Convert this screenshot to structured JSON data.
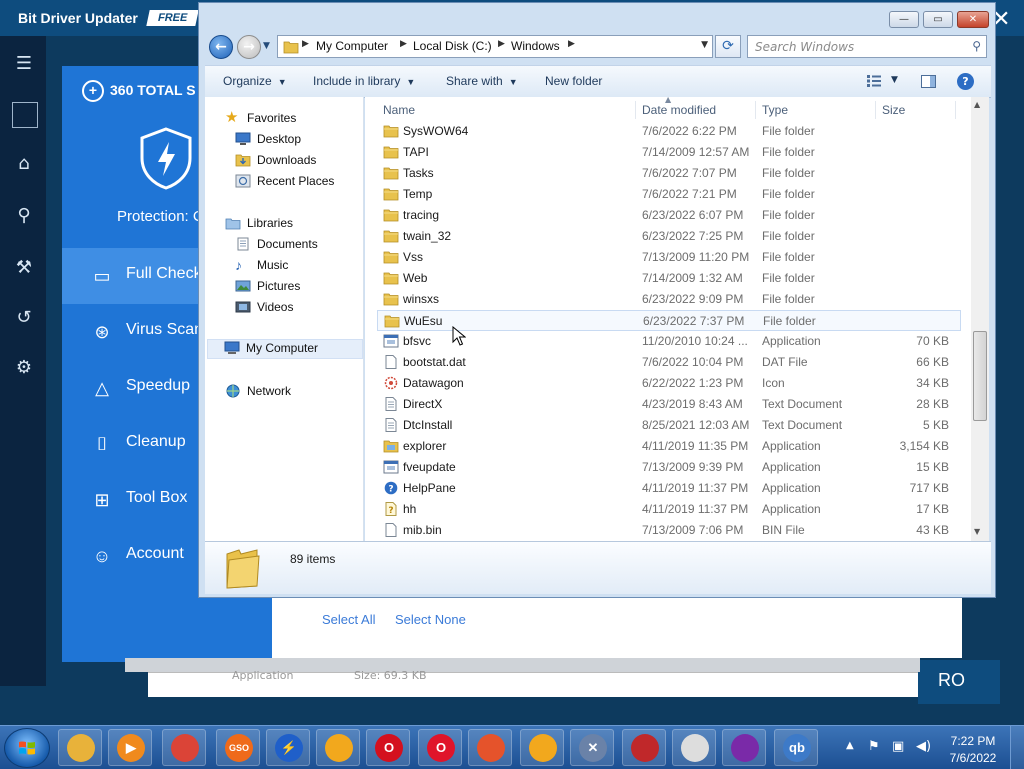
{
  "bg_app": {
    "title": "Bit Driver Updater",
    "badge": "FREE",
    "pro_text": "RO"
  },
  "security_app": {
    "brand": "360 TOTAL S",
    "protection": "Protection: C",
    "menu": [
      {
        "label": "Full Check",
        "icon": "monitor-icon",
        "active": true
      },
      {
        "label": "Virus Scan",
        "icon": "virus-scan-icon"
      },
      {
        "label": "Speedup",
        "icon": "rocket-icon"
      },
      {
        "label": "Cleanup",
        "icon": "broom-icon"
      },
      {
        "label": "Tool Box",
        "icon": "toolbox-icon"
      },
      {
        "label": "Account",
        "icon": "account-icon"
      }
    ],
    "select_all": "Select All",
    "select_none": "Select None",
    "strip_text_1": "Application",
    "strip_text_2": "Size: 69.3 KB"
  },
  "explorer": {
    "address": [
      "My Computer",
      "Local Disk (C:)",
      "Windows"
    ],
    "search_placeholder": "Search Windows",
    "toolbar": {
      "organize": "Organize",
      "include": "Include in library",
      "share": "Share with",
      "new_folder": "New folder"
    },
    "nav": {
      "favorites": "Favorites",
      "favorites_items": [
        "Desktop",
        "Downloads",
        "Recent Places"
      ],
      "libraries": "Libraries",
      "libraries_items": [
        "Documents",
        "Music",
        "Pictures",
        "Videos"
      ],
      "computer": "My Computer",
      "network": "Network"
    },
    "columns": {
      "name": "Name",
      "date": "Date modified",
      "type": "Type",
      "size": "Size"
    },
    "files": [
      {
        "name": "SysWOW64",
        "date": "7/6/2022 6:22 PM",
        "type": "File folder",
        "size": "",
        "icon": "folder"
      },
      {
        "name": "TAPI",
        "date": "7/14/2009 12:57 AM",
        "type": "File folder",
        "size": "",
        "icon": "folder"
      },
      {
        "name": "Tasks",
        "date": "7/6/2022 7:07 PM",
        "type": "File folder",
        "size": "",
        "icon": "folder"
      },
      {
        "name": "Temp",
        "date": "7/6/2022 7:21 PM",
        "type": "File folder",
        "size": "",
        "icon": "folder"
      },
      {
        "name": "tracing",
        "date": "6/23/2022 6:07 PM",
        "type": "File folder",
        "size": "",
        "icon": "folder"
      },
      {
        "name": "twain_32",
        "date": "6/23/2022 7:25 PM",
        "type": "File folder",
        "size": "",
        "icon": "folder"
      },
      {
        "name": "Vss",
        "date": "7/13/2009 11:20 PM",
        "type": "File folder",
        "size": "",
        "icon": "folder"
      },
      {
        "name": "Web",
        "date": "7/14/2009 1:32 AM",
        "type": "File folder",
        "size": "",
        "icon": "folder"
      },
      {
        "name": "winsxs",
        "date": "6/23/2022 9:09 PM",
        "type": "File folder",
        "size": "",
        "icon": "folder"
      },
      {
        "name": "WuEsu",
        "date": "6/23/2022 7:37 PM",
        "type": "File folder",
        "size": "",
        "icon": "folder"
      },
      {
        "name": "bfsvc",
        "date": "11/20/2010 10:24 ...",
        "type": "Application",
        "size": "70 KB",
        "icon": "app"
      },
      {
        "name": "bootstat.dat",
        "date": "7/6/2022 10:04 PM",
        "type": "DAT File",
        "size": "66 KB",
        "icon": "file"
      },
      {
        "name": "Datawagon",
        "date": "6/22/2022 1:23 PM",
        "type": "Icon",
        "size": "34 KB",
        "icon": "ico"
      },
      {
        "name": "DirectX",
        "date": "4/23/2019 8:43 AM",
        "type": "Text Document",
        "size": "28 KB",
        "icon": "text"
      },
      {
        "name": "DtcInstall",
        "date": "8/25/2021 12:03 AM",
        "type": "Text Document",
        "size": "5 KB",
        "icon": "text"
      },
      {
        "name": "explorer",
        "date": "4/11/2019 11:35 PM",
        "type": "Application",
        "size": "3,154 KB",
        "icon": "explorer"
      },
      {
        "name": "fveupdate",
        "date": "7/13/2009 9:39 PM",
        "type": "Application",
        "size": "15 KB",
        "icon": "app"
      },
      {
        "name": "HelpPane",
        "date": "4/11/2019 11:37 PM",
        "type": "Application",
        "size": "717 KB",
        "icon": "help"
      },
      {
        "name": "hh",
        "date": "4/11/2019 11:37 PM",
        "type": "Application",
        "size": "17 KB",
        "icon": "hh"
      },
      {
        "name": "mib.bin",
        "date": "7/13/2009 7:06 PM",
        "type": "BIN File",
        "size": "43 KB",
        "icon": "file"
      }
    ],
    "item_count": "89 items"
  },
  "taskbar": {
    "apps": [
      {
        "name": "windows-explorer",
        "color": "#e8b23a",
        "glyph": ""
      },
      {
        "name": "media-player",
        "color": "#f08a1d",
        "glyph": "▶"
      },
      {
        "name": "chrome",
        "color": "#db4437",
        "glyph": ""
      },
      {
        "name": "iobit-gso",
        "color": "#ef6a1a",
        "glyph": "GSO"
      },
      {
        "name": "shield-app",
        "color": "#1f5fc9",
        "glyph": "⚡"
      },
      {
        "name": "torch-browser",
        "color": "#f2a81d",
        "glyph": ""
      },
      {
        "name": "opera",
        "color": "#d4101e",
        "glyph": "O"
      },
      {
        "name": "opera-gx",
        "color": "#e0142a",
        "glyph": "O"
      },
      {
        "name": "office-app",
        "color": "#e5532b",
        "glyph": ""
      },
      {
        "name": "avira-chrome",
        "color": "#f2a81d",
        "glyph": ""
      },
      {
        "name": "tool-app",
        "color": "#6a82a8",
        "glyph": "✕"
      },
      {
        "name": "reddisk-app",
        "color": "#c0282a",
        "glyph": ""
      },
      {
        "name": "hat-app",
        "color": "#ddd",
        "glyph": ""
      },
      {
        "name": "winrar",
        "color": "#7a2aa8",
        "glyph": ""
      },
      {
        "name": "qbittorrent",
        "color": "#3d7ac8",
        "glyph": "qb"
      }
    ],
    "clock_time": "7:22 PM",
    "clock_date": "7/6/2022"
  }
}
